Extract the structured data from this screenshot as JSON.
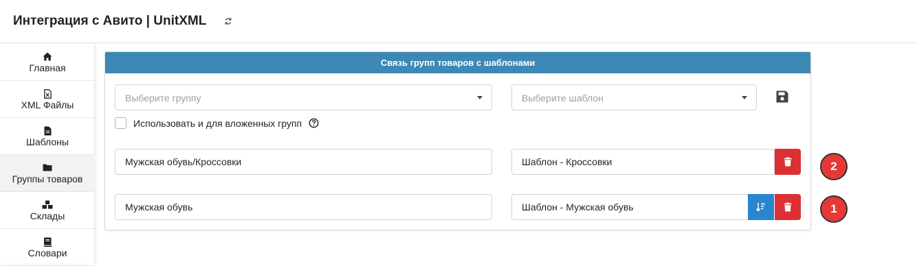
{
  "header": {
    "title": "Интеграция с Авито | UnitXML",
    "refresh_icon": "refresh-icon"
  },
  "sidebar": {
    "items": [
      {
        "label": "Главная",
        "icon": "home-icon"
      },
      {
        "label": "XML Файлы",
        "icon": "xml-file-icon"
      },
      {
        "label": "Шаблоны",
        "icon": "file-icon"
      },
      {
        "label": "Группы товаров",
        "icon": "folder-icon",
        "active": true
      },
      {
        "label": "Склады",
        "icon": "boxes-icon"
      },
      {
        "label": "Словари",
        "icon": "book-icon"
      }
    ]
  },
  "panel": {
    "title": "Связь групп товаров с шаблонами",
    "group_select": {
      "placeholder": "Выберите группу"
    },
    "template_select": {
      "placeholder": "Выберите шаблон"
    },
    "save_icon": "save-icon",
    "nested_checkbox": {
      "label": "Использовать и для вложенных групп",
      "checked": false,
      "help_icon": "question-circle-icon"
    },
    "rows": [
      {
        "group": "Мужская обувь/Кроссовки",
        "template": "Шаблон - Кроссовки",
        "badge": "2"
      },
      {
        "group": "Мужская обувь",
        "template": "Шаблон - Мужская обувь",
        "badge": "1"
      }
    ]
  },
  "colors": {
    "panel_header": "#3d88b5",
    "danger": "#dc3035",
    "primary": "#2a85d0",
    "badge": "#e53935"
  }
}
